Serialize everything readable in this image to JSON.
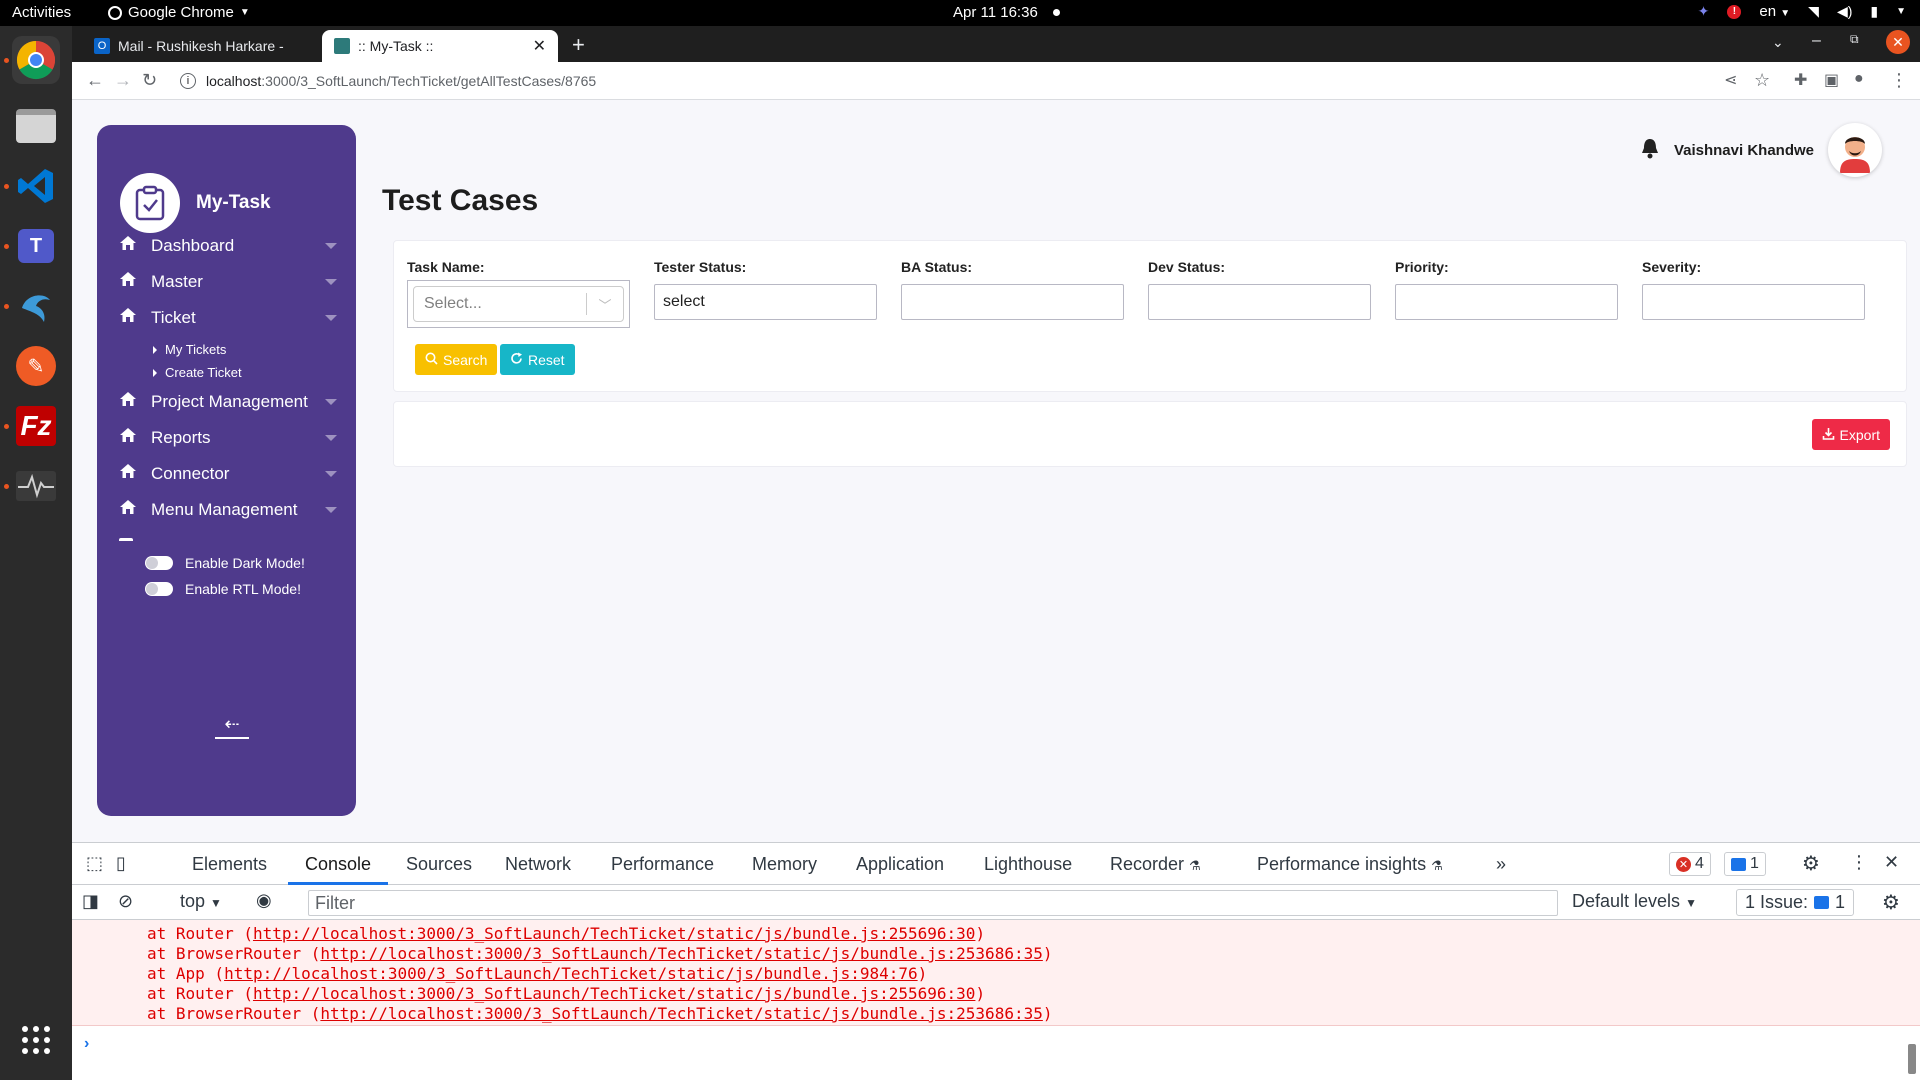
{
  "os": {
    "activities": "Activities",
    "app_name": "Google Chrome",
    "clock": "Apr 11  16:36",
    "language": "en"
  },
  "browser": {
    "tabs": [
      {
        "title": "Mail - Rushikesh Harkare -"
      },
      {
        "title": ":: My-Task ::"
      }
    ],
    "url_host": "localhost",
    "url_path": ":3000/3_SoftLaunch/TechTicket/getAllTestCases/8765"
  },
  "sidebar": {
    "brand": "My-Task",
    "items": [
      {
        "label": "Dashboard"
      },
      {
        "label": "Master"
      },
      {
        "label": "Ticket"
      },
      {
        "label": "Project Management"
      },
      {
        "label": "Reports"
      },
      {
        "label": "Connector"
      },
      {
        "label": "Menu Management"
      }
    ],
    "sub_items": [
      {
        "label": "My Tickets"
      },
      {
        "label": "Create Ticket"
      }
    ],
    "dark_mode_label": "Enable Dark Mode!",
    "rtl_mode_label": "Enable RTL Mode!"
  },
  "header": {
    "user_name": "Vaishnavi Khandwe"
  },
  "page": {
    "title": "Test Cases"
  },
  "filters": {
    "task_name_label": "Task Name:",
    "task_name_placeholder": "Select...",
    "tester_status_label": "Tester Status:",
    "tester_status_value": "select",
    "ba_status_label": "BA Status:",
    "ba_status_value": "",
    "dev_status_label": "Dev Status:",
    "dev_status_value": "",
    "priority_label": "Priority:",
    "priority_value": "",
    "severity_label": "Severity:",
    "severity_value": "",
    "search_label": "Search",
    "reset_label": "Reset",
    "export_label": "Export"
  },
  "devtools": {
    "tabs": [
      {
        "label": "Elements"
      },
      {
        "label": "Console"
      },
      {
        "label": "Sources"
      },
      {
        "label": "Network"
      },
      {
        "label": "Performance"
      },
      {
        "label": "Memory"
      },
      {
        "label": "Application"
      },
      {
        "label": "Lighthouse"
      },
      {
        "label": "Recorder"
      },
      {
        "label": "Performance insights"
      }
    ],
    "error_count": "4",
    "message_count": "1",
    "context": "top",
    "filter_placeholder": "Filter",
    "levels": "Default levels",
    "issues_label": "1 Issue:",
    "issues_count": "1",
    "console_lines": [
      {
        "prefix": "at Router (",
        "url": "http://localhost:3000/3_SoftLaunch/TechTicket/static/js/bundle.js:255696:30",
        "suffix": ")"
      },
      {
        "prefix": "at BrowserRouter (",
        "url": "http://localhost:3000/3_SoftLaunch/TechTicket/static/js/bundle.js:253686:35",
        "suffix": ")"
      },
      {
        "prefix": "at App (",
        "url": "http://localhost:3000/3_SoftLaunch/TechTicket/static/js/bundle.js:984:76",
        "suffix": ")"
      },
      {
        "prefix": "at Router (",
        "url": "http://localhost:3000/3_SoftLaunch/TechTicket/static/js/bundle.js:255696:30",
        "suffix": ")"
      },
      {
        "prefix": "at BrowserRouter (",
        "url": "http://localhost:3000/3_SoftLaunch/TechTicket/static/js/bundle.js:253686:35",
        "suffix": ")"
      }
    ]
  },
  "colors": {
    "sidebar_bg": "#4f3a8c",
    "search_btn": "#f8c000",
    "reset_btn": "#17b6c8",
    "export_btn": "#ee2a47"
  }
}
